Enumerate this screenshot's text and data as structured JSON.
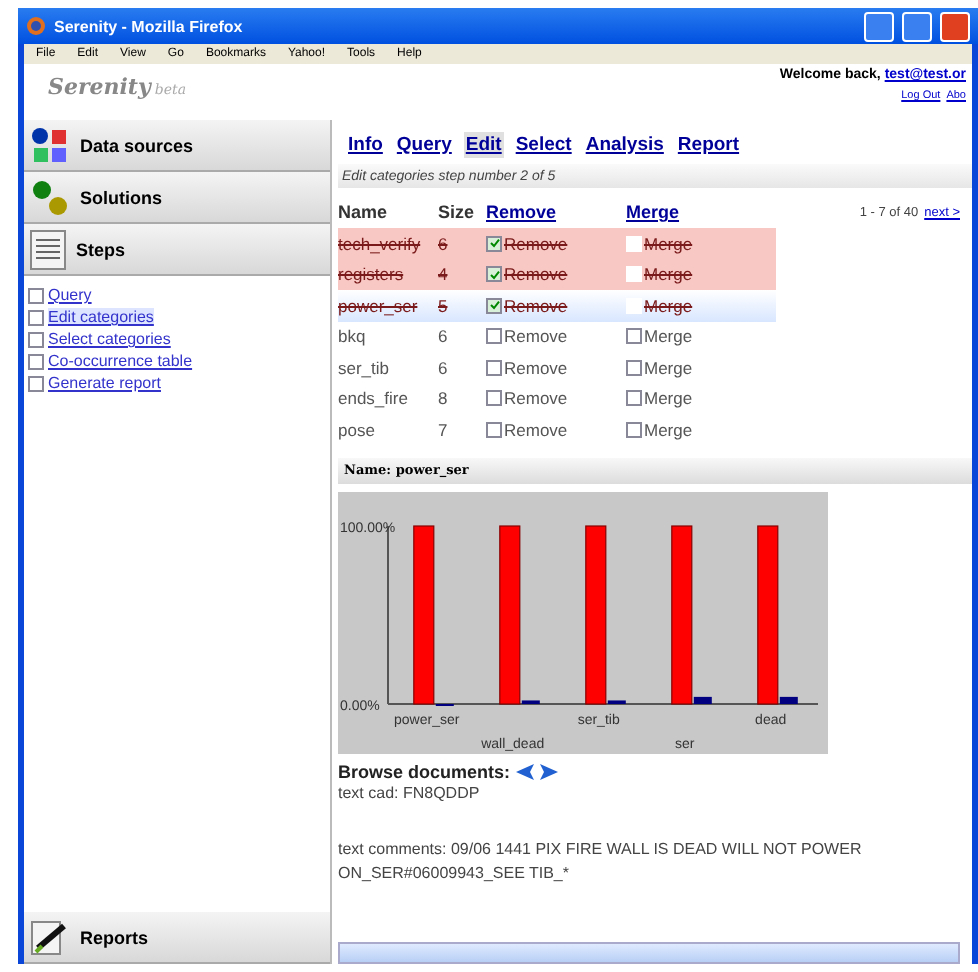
{
  "window": {
    "title": "Serenity - Mozilla Firefox"
  },
  "menu": [
    "File",
    "Edit",
    "View",
    "Go",
    "Bookmarks",
    "Yahoo!",
    "Tools",
    "Help"
  ],
  "header": {
    "logo": "Serenity",
    "logo_suffix": "beta",
    "welcome": "Welcome back,",
    "user": "test@test.or",
    "links": [
      "Log Out",
      "Abo"
    ]
  },
  "sidebar": {
    "panels": [
      {
        "label": "Data sources",
        "kind": "sources"
      },
      {
        "label": "Solutions",
        "kind": "solutions"
      },
      {
        "label": "Steps",
        "kind": "steps"
      }
    ],
    "steps": [
      {
        "label": "Query",
        "selected": false,
        "checked": false
      },
      {
        "label": "Edit categories",
        "selected": true,
        "checked": false
      },
      {
        "label": "Select categories",
        "selected": false,
        "checked": false
      },
      {
        "label": "Co-occurrence table",
        "selected": false,
        "checked": false
      },
      {
        "label": "Generate report",
        "selected": false,
        "checked": false
      }
    ],
    "bottom_panel": {
      "label": "Reports"
    }
  },
  "tabs": [
    {
      "label": "Info",
      "selected": false
    },
    {
      "label": "Query",
      "selected": false
    },
    {
      "label": "Edit",
      "selected": true
    },
    {
      "label": "Select",
      "selected": false
    },
    {
      "label": "Analysis",
      "selected": false
    },
    {
      "label": "Report",
      "selected": false
    }
  ],
  "step_caption": "Edit categories step number 2 of 5",
  "table": {
    "columns": [
      "Name",
      "Size",
      "Remove",
      "Merge"
    ],
    "pager": "1 - 7 of 40",
    "next": "next >",
    "rows": [
      {
        "name": "tech_verify",
        "size": "6",
        "remove": "Remove",
        "removed": true,
        "merge": "Merge",
        "merged": false,
        "selected": false
      },
      {
        "name": "registers",
        "size": "4",
        "remove": "Remove",
        "removed": true,
        "merge": "Merge",
        "merged": false,
        "selected": false
      },
      {
        "name": "power_ser",
        "size": "5",
        "remove": "Remove",
        "removed": true,
        "merge": "Merge",
        "merged": false,
        "selected": true
      },
      {
        "name": "bkq",
        "size": "6",
        "remove": "Remove",
        "removed": false,
        "merge": "Merge",
        "merged": false,
        "selected": false
      },
      {
        "name": "ser_tib",
        "size": "6",
        "remove": "Remove",
        "removed": false,
        "merge": "Merge",
        "merged": false,
        "selected": false
      },
      {
        "name": "ends_fire",
        "size": "8",
        "remove": "Remove",
        "removed": false,
        "merge": "Merge",
        "merged": false,
        "selected": false
      },
      {
        "name": "pose",
        "size": "7",
        "remove": "Remove",
        "removed": false,
        "merge": "Merge",
        "merged": false,
        "selected": false
      }
    ]
  },
  "detail": {
    "title": "Name: power_ser",
    "chart_data": {
      "type": "bar",
      "categories": [
        "power_ser",
        "wall_dead",
        "ser_tib",
        "ser",
        "dead"
      ],
      "ylim": [
        0,
        1
      ],
      "yticks": [
        {
          "value": 0,
          "label": "0.00%"
        },
        {
          "value": 1,
          "label": "100.00%"
        }
      ],
      "series": [
        {
          "color": "#ff0000",
          "values": [
            1,
            1,
            1,
            1,
            1
          ]
        },
        {
          "color": "#000080",
          "values": [
            0,
            0.02,
            0.02,
            0.04,
            0.04
          ]
        }
      ]
    },
    "browse_label": "Browse documents:",
    "lines": [
      "text cad: FN8QDDP",
      "text comments: 09/06 1441 PIX FIRE WALL IS DEAD WILL NOT POWER ON_SER#06009943_SEE TIB_*"
    ]
  }
}
